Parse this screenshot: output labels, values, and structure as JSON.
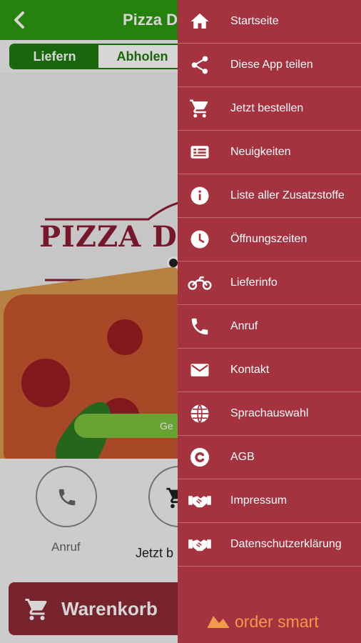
{
  "header": {
    "title": "Pizza Dri"
  },
  "tabs": [
    {
      "label": "Liefern",
      "active": true
    },
    {
      "label": "Abholen",
      "active": false
    }
  ],
  "hero": {
    "logo_text": "PIZZA D",
    "pill_text": "Ge"
  },
  "actions": [
    {
      "label": "Anruf",
      "icon": "phone-icon"
    },
    {
      "label": "Jetzt b",
      "icon": "cart-icon"
    }
  ],
  "cart": {
    "label": "Warenkorb"
  },
  "drawer": {
    "items": [
      {
        "label": "Startseite",
        "icon": "home-icon"
      },
      {
        "label": "Diese App teilen",
        "icon": "share-icon"
      },
      {
        "label": "Jetzt bestellen",
        "icon": "cart-icon"
      },
      {
        "label": "Neuigkeiten",
        "icon": "news-icon"
      },
      {
        "label": "Liste aller Zusatzstoffe",
        "icon": "info-icon"
      },
      {
        "label": "Öffnungszeiten",
        "icon": "clock-icon"
      },
      {
        "label": "Lieferinfo",
        "icon": "motorbike-icon"
      },
      {
        "label": "Anruf",
        "icon": "phone-icon"
      },
      {
        "label": "Kontakt",
        "icon": "mail-icon"
      },
      {
        "label": "Sprachauswahl",
        "icon": "globe-icon"
      },
      {
        "label": "AGB",
        "icon": "copyright-icon"
      },
      {
        "label": "Impressum",
        "icon": "handshake-icon"
      },
      {
        "label": "Datenschutzerklärung",
        "icon": "handshake-icon"
      }
    ],
    "brand": "order smart"
  },
  "colors": {
    "header_green": "#2f9a12",
    "drawer_red": "#a5323f",
    "brand_orange": "#f09a4a",
    "cart_red": "#8e2a35"
  }
}
